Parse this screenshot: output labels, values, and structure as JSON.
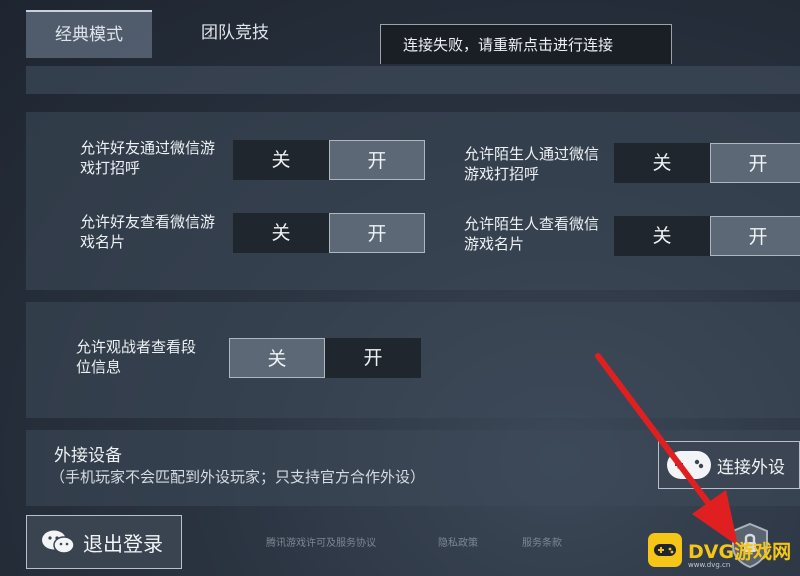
{
  "tabs": {
    "classic": "经典模式",
    "team": "团队竞技"
  },
  "toast": "连接失败，请重新点击进行连接",
  "privacy": {
    "friend_greet": {
      "label": "允许好友通过微信游戏打招呼",
      "off": "关",
      "on": "开",
      "selected": "on"
    },
    "friend_card": {
      "label": "允许好友查看微信游戏名片",
      "off": "关",
      "on": "开",
      "selected": "on"
    },
    "stranger_greet": {
      "label": "允许陌生人通过微信游戏打招呼",
      "off": "关",
      "on": "开",
      "selected": "on"
    },
    "stranger_card": {
      "label": "允许陌生人查看微信游戏名片",
      "off": "关",
      "on": "开",
      "selected": "on"
    },
    "spectator_rank": {
      "label": "允许观战者查看段位信息",
      "off": "关",
      "on": "开",
      "selected": "off"
    }
  },
  "device": {
    "title": "外接设备",
    "note": "（手机玩家不会匹配到外设玩家；只支持官方合作外设）",
    "connect_label": "连接外设",
    "connect_icon": "gamepad-icon"
  },
  "footer": {
    "logout_label": "退出登录",
    "logout_icon": "wechat-icon",
    "link1": "腾讯游戏许可及服务协议",
    "link2": "隐私政策",
    "link3": "服务条款",
    "shield_icon": "shield-icon"
  },
  "watermark": {
    "text": "DVG游戏网",
    "sub": "www.dvg.cn"
  },
  "colors": {
    "toggle_selected": "#5c6875",
    "toggle_unselected": "#1f262e",
    "annotation_arrow": "#e02020",
    "watermark": "#f5c518"
  }
}
